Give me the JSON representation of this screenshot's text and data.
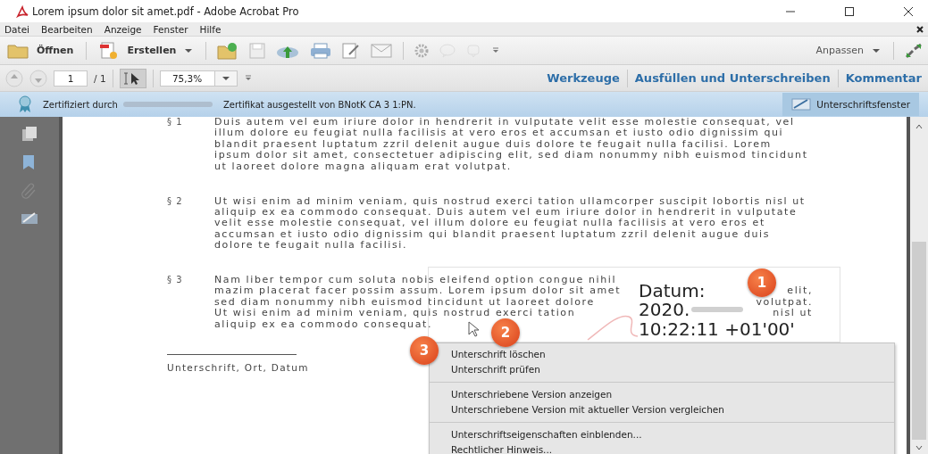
{
  "window": {
    "title": "Lorem ipsum dolor sit amet.pdf - Adobe Acrobat Pro"
  },
  "menu_bar": {
    "items": [
      "Datei",
      "Bearbeiten",
      "Anzeige",
      "Fenster",
      "Hilfe"
    ]
  },
  "toolbar": {
    "open_label": "Öffnen",
    "create_label": "Erstellen",
    "customize_label": "Anpassen"
  },
  "nav_bar": {
    "page": "1",
    "page_count": "/ 1",
    "zoom": "75,3%",
    "panes": [
      {
        "label": "Werkzeuge"
      },
      {
        "label": "Ausfüllen und Unterschreiben"
      },
      {
        "label": "Kommentar"
      }
    ]
  },
  "cert_bar": {
    "text_before": "Zertifiziert durch",
    "text_after": "Zertifikat ausgestellt von BNotK CA 3 1:PN.",
    "button": "Unterschriftsfenster"
  },
  "document": {
    "sections": [
      {
        "number": "§ 1",
        "text": "Duis autem vel eum iriure dolor in hendrerit in vulputate velit esse molestie consequat, vel illum dolore eu feugiat nulla facilisis at vero eros et accumsan et iusto odio dignissim qui blandit praesent luptatum zzril delenit augue duis dolore te feugait nulla facilisi. Lorem ipsum dolor sit amet, consectetuer adipiscing elit, sed diam nonummy nibh euismod tincidunt ut laoreet dolore magna aliquam erat volutpat."
      },
      {
        "number": "§ 2",
        "text": "Ut wisi enim ad minim veniam, quis nostrud exerci tation ullamcorper suscipit lobortis nisl ut aliquip ex ea commodo consequat. Duis autem vel eum iriure dolor in hendrerit in vulputate velit esse molestie consequat, vel illum dolore eu feugiat nulla facilisis at vero eros et accumsan et iusto odio dignissim qui blandit praesent luptatum zzril delenit augue duis dolore te feugait nulla facilisi."
      },
      {
        "number": "§ 3",
        "lines": [
          [
            "Nam liber tempor cum soluta nobis eleifend option congue nihil"
          ],
          [
            "mazim placerat facer possim assum. Lorem ipsum dolor sit amet",
            "elit,"
          ],
          [
            "sed diam nonummy nibh euismod tincidunt ut laoreet dolore",
            "volutpat."
          ],
          [
            "Ut wisi enim ad minim veniam, quis nostrud exerci tation",
            "nisl ut"
          ],
          [
            "aliquip ex ea commodo consequat."
          ]
        ]
      }
    ],
    "signature_line_label": "Unterschrift, Ort, Datum",
    "signature_field": {
      "lines": [
        "Datum:",
        "2020.",
        "10:22:11 +01'00'"
      ]
    }
  },
  "callouts": [
    "1",
    "2",
    "3"
  ],
  "context_menu": {
    "groups": [
      [
        "Unterschrift löschen",
        "Unterschrift prüfen"
      ],
      [
        "Unterschriebene Version anzeigen",
        "Unterschriebene Version mit aktueller Version vergleichen"
      ],
      [
        "Unterschriftseigenschaften einblenden...",
        "Rechtlicher Hinweis..."
      ]
    ]
  }
}
